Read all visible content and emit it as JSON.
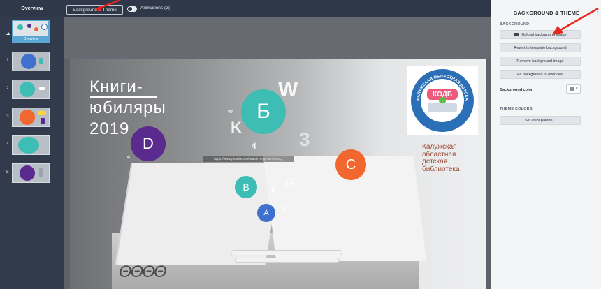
{
  "topbar": {
    "overview_label": "Overview",
    "background_theme_button": "Background & Theme",
    "animations_label": "Animations (2)"
  },
  "rail": {
    "overview_label": "Overview",
    "slides": [
      {
        "num": "1"
      },
      {
        "num": "2"
      },
      {
        "num": "3"
      },
      {
        "num": "4"
      },
      {
        "num": "5"
      }
    ]
  },
  "slide": {
    "title_line1": "Книги-",
    "title_line2": "юбиляры",
    "title_line3": "2019",
    "url_text": "https://www.youtube.com/watch?v=gs-kIzmwkcQ",
    "library_name": [
      "Калужская",
      "областная",
      "детская",
      "библиотека"
    ],
    "logo_badge": "КОДБ",
    "logo_ring_text": "КАЛУЖСКАЯ ОБЛАСТНАЯ ДЕТСКАЯ БИБЛИОТЕКА",
    "circles": {
      "b_cyr": "Б",
      "d": "D",
      "c": "C",
      "b": "B",
      "a": "A"
    },
    "floating_letters": {
      "w_big": "W",
      "w_small": "w",
      "k": "K",
      "num4": "4",
      "num3": "3",
      "num4b": "4",
      "k_small": "к",
      "g": "G",
      "x": "х"
    }
  },
  "panel": {
    "title": "BACKGROUND & THEME",
    "more": "⋮",
    "background_section": "BACKGROUND",
    "upload_button": "Upload background image",
    "revert_button": "Revert to template background",
    "remove_button": "Remove background image",
    "fit_button": "Fit background to overview",
    "bg_color_label": "Background color",
    "bg_color_caret": "▾",
    "theme_section": "THEME COLORS",
    "palette_button": "Set color palette..."
  },
  "colors": {
    "annotation_arrow": "#e8261f",
    "teal": "#3dbdb3",
    "purple": "#5a2a8f",
    "orange": "#f2672f",
    "blue": "#3f6fcf"
  }
}
